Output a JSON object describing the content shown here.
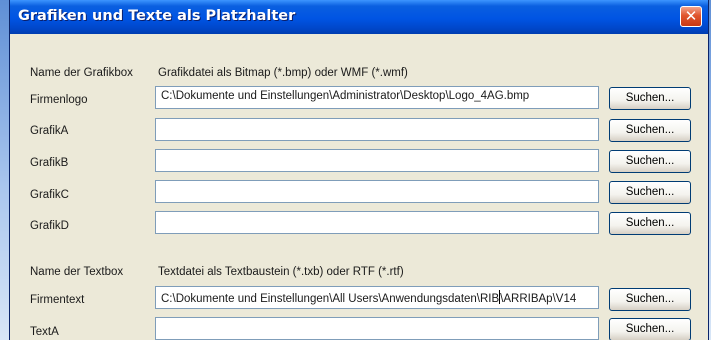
{
  "window": {
    "title": "Grafiken und Texte als Platzhalter",
    "close_symbol": "✕"
  },
  "graphics": {
    "name_header": "Name der Grafikbox",
    "file_header": "Grafikdatei als Bitmap (*.bmp) oder WMF (*.wmf)",
    "rows": [
      {
        "label": "Firmenlogo",
        "value": "C:\\Dokumente und Einstellungen\\Administrator\\Desktop\\Logo_4AG.bmp",
        "button": "Suchen..."
      },
      {
        "label": "GrafikA",
        "value": "",
        "button": "Suchen..."
      },
      {
        "label": "GrafikB",
        "value": "",
        "button": "Suchen..."
      },
      {
        "label": "GrafikC",
        "value": "",
        "button": "Suchen..."
      },
      {
        "label": "GrafikD",
        "value": "",
        "button": "Suchen..."
      }
    ]
  },
  "texts": {
    "name_header": "Name der Textbox",
    "file_header": "Textdatei als Textbaustein (*.txb) oder RTF (*.rtf)",
    "rows": [
      {
        "label": "Firmentext",
        "value_before_caret": "C:\\Dokumente und Einstellungen\\All Users\\Anwendungsdaten\\RIB",
        "value_after_caret": "\\ARRIBAp\\V14",
        "button": "Suchen..."
      },
      {
        "label": "TextA",
        "value": "",
        "button": "Suchen..."
      }
    ]
  }
}
